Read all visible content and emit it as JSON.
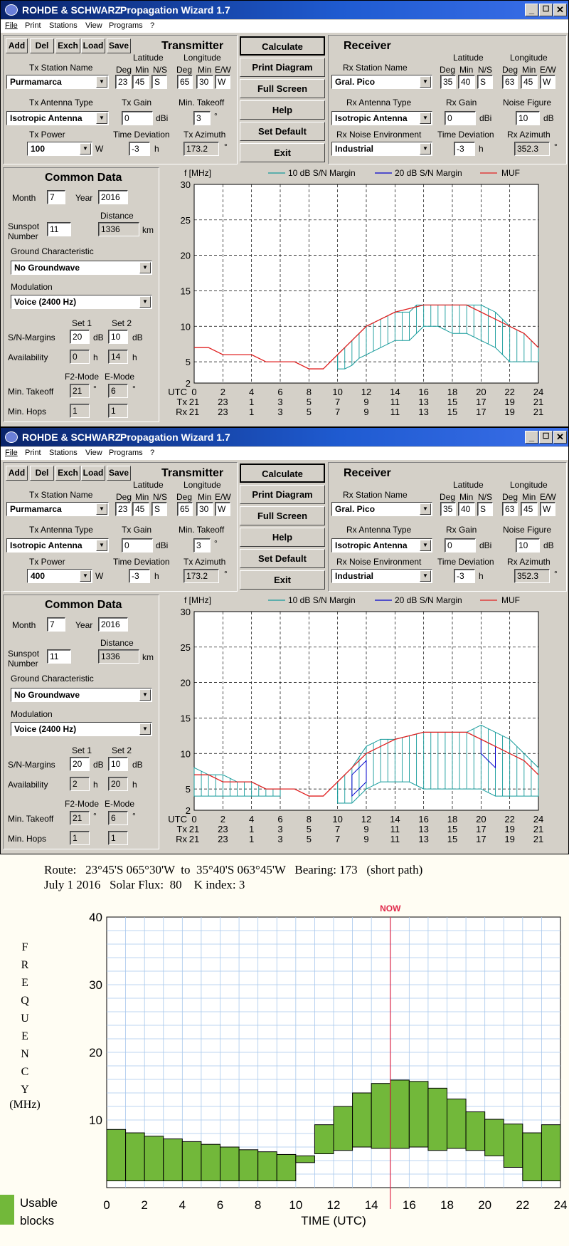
{
  "app": {
    "logo": "ROHDE & SCHWARZ",
    "title": "Propagation Wizard  1.7",
    "min": "_",
    "max": "☐",
    "close": "✕"
  },
  "menu": [
    "File",
    "Print",
    "Stations",
    "View",
    "Programs",
    "?"
  ],
  "tool_buttons": [
    "Add",
    "Del",
    "Exch",
    "Load",
    "Save"
  ],
  "center_buttons": [
    "Calculate",
    "Print Diagram",
    "Full Screen",
    "Help",
    "Set Default",
    "Exit"
  ],
  "labels": {
    "transmitter": "Transmitter",
    "receiver": "Receiver",
    "latitude": "Latitude",
    "longitude": "Longitude",
    "deg": "Deg",
    "min": "Min",
    "ns": "N/S",
    "ew": "E/W",
    "tx_station_name": "Tx Station Name",
    "rx_station_name": "Rx Station Name",
    "tx_antenna_type": "Tx Antenna Type",
    "rx_antenna_type": "Rx Antenna Type",
    "tx_gain": "Tx Gain",
    "rx_gain": "Rx Gain",
    "min_takeoff": "Min. Takeoff",
    "noise_figure": "Noise Figure",
    "tx_power": "Tx Power",
    "rx_noise_env": "Rx Noise Environment",
    "time_deviation": "Time Deviation",
    "tx_azimuth": "Tx Azimuth",
    "rx_azimuth": "Rx Azimuth",
    "dbi": "dBi",
    "db": "dB",
    "w": "W",
    "h": "h",
    "deg_sym": "°",
    "km": "km",
    "common_data": "Common Data",
    "month": "Month",
    "year": "Year",
    "sunspot": "Sunspot",
    "number": "Number",
    "distance": "Distance",
    "ground": "Ground Characteristic",
    "modulation": "Modulation",
    "set1": "Set 1",
    "set2": "Set 2",
    "sn_margins": "S/N-Margins",
    "availability": "Availability",
    "f2mode": "F2-Mode",
    "emode": "E-Mode",
    "min_takeoff2": "Min. Takeoff",
    "min_hops": "Min. Hops",
    "fmhz": "f [MHz]",
    "legend10": "10 dB S/N Margin",
    "legend20": "20 dB S/N Margin",
    "legendmuf": "MUF",
    "utc": "UTC",
    "tx": "Tx",
    "rx": "Rx"
  },
  "windows": [
    {
      "tx_name": "Purmamarca",
      "tx_lat": [
        "23",
        "45",
        "S"
      ],
      "tx_lon": [
        "65",
        "30",
        "W"
      ],
      "tx_antenna": "Isotropic Antenna",
      "tx_gain": "0",
      "tx_takeoff": "3",
      "tx_power": "100",
      "tx_timedev": "-3",
      "tx_azimuth": "173.2",
      "rx_name": "Gral. Pico",
      "rx_lat": [
        "35",
        "40",
        "S"
      ],
      "rx_lon": [
        "63",
        "45",
        "W"
      ],
      "rx_antenna": "Isotropic Antenna",
      "rx_gain": "0",
      "rx_noise_figure": "10",
      "rx_noise_env": "Industrial",
      "rx_timedev": "-3",
      "rx_azimuth": "352.3",
      "month": "7",
      "year": "2016",
      "sunspot": "11",
      "distance": "1336",
      "ground": "No Groundwave",
      "modulation": "Voice   (2400 Hz)",
      "sn_set1": "20",
      "sn_set2": "10",
      "avail_set1": "0",
      "avail_set2": "14",
      "f2_takeoff": "21",
      "e_takeoff": "6",
      "f2_hops": "1",
      "e_hops": "1",
      "plot": {
        "muf": [
          [
            0,
            7
          ],
          [
            1,
            7
          ],
          [
            2,
            6
          ],
          [
            3,
            6
          ],
          [
            4,
            6
          ],
          [
            5,
            5
          ],
          [
            6,
            5
          ],
          [
            7,
            5
          ],
          [
            8,
            4
          ],
          [
            9,
            4
          ],
          [
            10,
            6
          ],
          [
            11,
            8
          ],
          [
            12,
            10
          ],
          [
            13,
            11
          ],
          [
            14,
            12
          ],
          [
            15,
            12.5
          ],
          [
            16,
            13
          ],
          [
            17,
            13
          ],
          [
            18,
            13
          ],
          [
            19,
            13
          ],
          [
            20,
            12
          ],
          [
            21,
            11
          ],
          [
            22,
            10
          ],
          [
            23,
            9
          ],
          [
            24,
            7
          ]
        ],
        "band10": [
          [
            10,
            4,
            6
          ],
          [
            10.5,
            4,
            7
          ],
          [
            11,
            4.5,
            8
          ],
          [
            11.5,
            5.5,
            9
          ],
          [
            12,
            6,
            10
          ],
          [
            13,
            7,
            11
          ],
          [
            14,
            8,
            12
          ],
          [
            15,
            8,
            12
          ],
          [
            15.5,
            9,
            13
          ],
          [
            16,
            10,
            13
          ],
          [
            17,
            10,
            13
          ],
          [
            18,
            9,
            13
          ],
          [
            19,
            9,
            13
          ],
          [
            20,
            8,
            13
          ],
          [
            21,
            7,
            12
          ],
          [
            22,
            5,
            10
          ],
          [
            23,
            5,
            9
          ],
          [
            24,
            5,
            7
          ]
        ],
        "band20": []
      }
    },
    {
      "tx_name": "Purmamarca",
      "tx_lat": [
        "23",
        "45",
        "S"
      ],
      "tx_lon": [
        "65",
        "30",
        "W"
      ],
      "tx_antenna": "Isotropic Antenna",
      "tx_gain": "0",
      "tx_takeoff": "3",
      "tx_power": "400",
      "tx_timedev": "-3",
      "tx_azimuth": "173.2",
      "rx_name": "Gral. Pico",
      "rx_lat": [
        "35",
        "40",
        "S"
      ],
      "rx_lon": [
        "63",
        "45",
        "W"
      ],
      "rx_antenna": "Isotropic Antenna",
      "rx_gain": "0",
      "rx_noise_figure": "10",
      "rx_noise_env": "Industrial",
      "rx_timedev": "-3",
      "rx_azimuth": "352.3",
      "month": "7",
      "year": "2016",
      "sunspot": "11",
      "distance": "1336",
      "ground": "No Groundwave",
      "modulation": "Voice   (2400 Hz)",
      "sn_set1": "20",
      "sn_set2": "10",
      "avail_set1": "2",
      "avail_set2": "20",
      "f2_takeoff": "21",
      "e_takeoff": "6",
      "f2_hops": "1",
      "e_hops": "1",
      "plot": {
        "muf": [
          [
            0,
            7
          ],
          [
            1,
            7
          ],
          [
            2,
            6
          ],
          [
            3,
            6
          ],
          [
            4,
            6
          ],
          [
            5,
            5
          ],
          [
            6,
            5
          ],
          [
            7,
            5
          ],
          [
            8,
            4
          ],
          [
            9,
            4
          ],
          [
            10,
            6
          ],
          [
            11,
            8
          ],
          [
            12,
            10
          ],
          [
            13,
            11
          ],
          [
            14,
            12
          ],
          [
            15,
            12.5
          ],
          [
            16,
            13
          ],
          [
            17,
            13
          ],
          [
            18,
            13
          ],
          [
            19,
            13
          ],
          [
            20,
            12
          ],
          [
            21,
            11
          ],
          [
            22,
            10
          ],
          [
            23,
            9
          ],
          [
            24,
            7
          ]
        ],
        "band10": [
          [
            0,
            4,
            8
          ],
          [
            1,
            4,
            7
          ],
          [
            2,
            4,
            7
          ],
          [
            3,
            4,
            6
          ],
          [
            4,
            4,
            6
          ],
          [
            5,
            4,
            5
          ],
          [
            6,
            4,
            5
          ],
          [
            6.1,
            null,
            null
          ],
          [
            10,
            3,
            6
          ],
          [
            11,
            3,
            8
          ],
          [
            12,
            5,
            11
          ],
          [
            13,
            6,
            12
          ],
          [
            14,
            6,
            12
          ],
          [
            15,
            6,
            12.5
          ],
          [
            16,
            5,
            13
          ],
          [
            17,
            5,
            13
          ],
          [
            18,
            5,
            13
          ],
          [
            19,
            5,
            13
          ],
          [
            20,
            5,
            14
          ],
          [
            21,
            4,
            13
          ],
          [
            22,
            4,
            12
          ],
          [
            23,
            4,
            10
          ],
          [
            24,
            4,
            8
          ]
        ],
        "band20": [
          [
            [
              11,
              4,
              7
            ],
            [
              12,
              6,
              9
            ]
          ],
          [
            [
              20,
              10,
              12
            ],
            [
              21,
              8,
              11
            ]
          ]
        ]
      }
    }
  ],
  "route": {
    "line1": "Route:   23°45'S 065°30'W  to  35°40'S 063°45'W   Bearing: 173   (short path)",
    "line2": "July 1 2016   Solar Flux:  80    K index: 3",
    "now": "NOW",
    "ylabel_letters": [
      "F",
      "R",
      "E",
      "Q",
      "U",
      "E",
      "N",
      "C",
      "Y"
    ],
    "ylabel_unit": "(MHz)",
    "xlabel": "TIME (UTC)",
    "legend": [
      "Usable",
      "blocks"
    ],
    "colors": {
      "block": "#72b83a",
      "now": "#e0284a"
    }
  },
  "chart_data": {
    "type": "bar",
    "x": [
      0,
      1,
      2,
      3,
      4,
      5,
      6,
      7,
      8,
      9,
      10,
      11,
      12,
      13,
      14,
      15,
      16,
      17,
      18,
      19,
      20,
      21,
      22,
      23
    ],
    "series": [
      {
        "name": "Usable blocks",
        "low": [
          1,
          1,
          1,
          1,
          1,
          1,
          1,
          1,
          1,
          1,
          3.7,
          5,
          5.5,
          6,
          5.8,
          5.8,
          6,
          5.5,
          5.8,
          5.5,
          4.7,
          3,
          1,
          1
        ],
        "high": [
          8.6,
          8.1,
          7.6,
          7.2,
          6.8,
          6.4,
          6,
          5.6,
          5.3,
          4.9,
          4.7,
          9.3,
          12,
          14,
          15.4,
          15.9,
          15.7,
          14.7,
          13.1,
          11.2,
          10.1,
          9.4,
          8.1,
          9.3
        ]
      }
    ],
    "xlabel": "TIME (UTC)",
    "ylabel": "FREQUENCY (MHz)",
    "xlim": [
      0,
      24
    ],
    "ylim": [
      0,
      40
    ],
    "xticks": [
      0,
      2,
      4,
      6,
      8,
      10,
      12,
      14,
      16,
      18,
      20,
      22,
      24
    ],
    "yticks": [
      10,
      20,
      30,
      40
    ],
    "now": 15
  }
}
